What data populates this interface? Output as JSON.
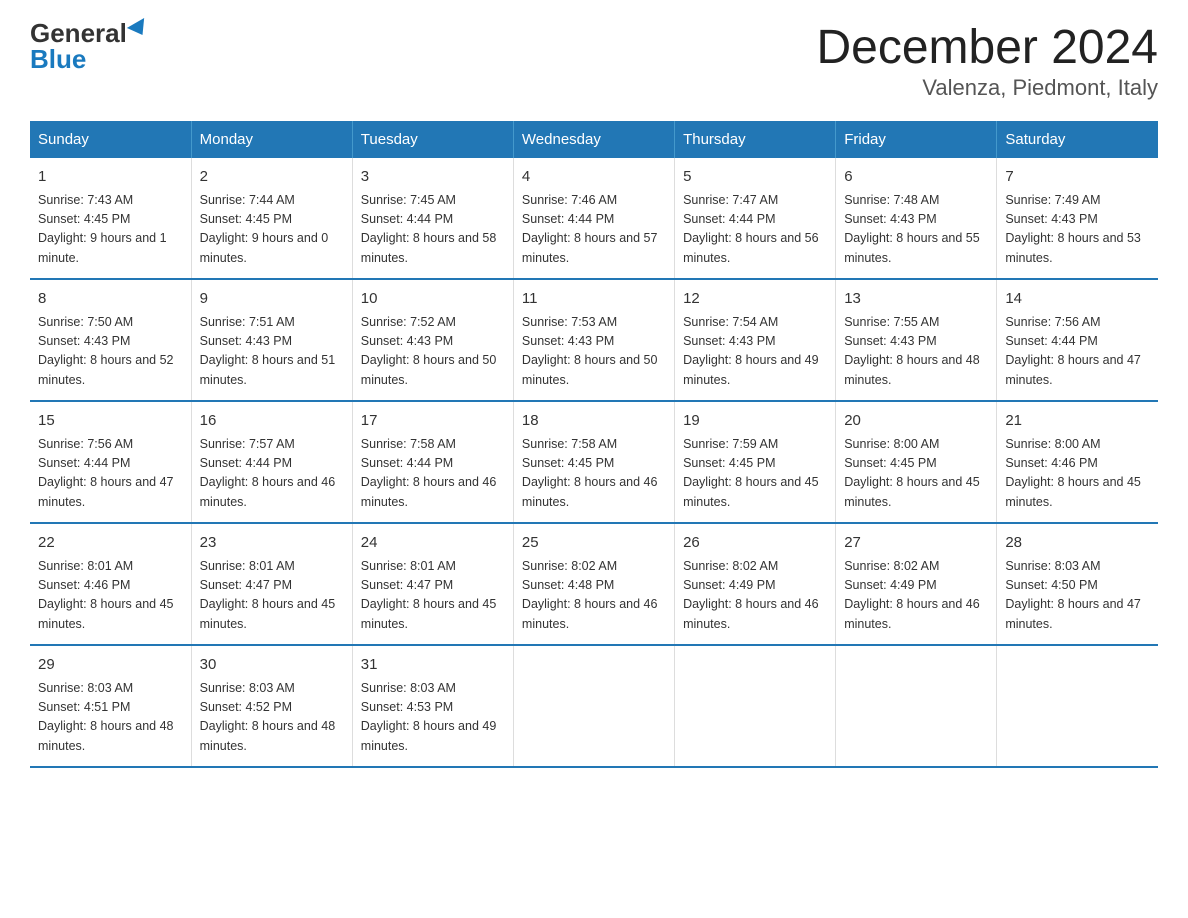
{
  "header": {
    "logo_general": "General",
    "logo_blue": "Blue",
    "title": "December 2024",
    "subtitle": "Valenza, Piedmont, Italy"
  },
  "columns": [
    "Sunday",
    "Monday",
    "Tuesday",
    "Wednesday",
    "Thursday",
    "Friday",
    "Saturday"
  ],
  "weeks": [
    [
      {
        "day": "1",
        "sunrise": "7:43 AM",
        "sunset": "4:45 PM",
        "daylight": "9 hours and 1 minute."
      },
      {
        "day": "2",
        "sunrise": "7:44 AM",
        "sunset": "4:45 PM",
        "daylight": "9 hours and 0 minutes."
      },
      {
        "day": "3",
        "sunrise": "7:45 AM",
        "sunset": "4:44 PM",
        "daylight": "8 hours and 58 minutes."
      },
      {
        "day": "4",
        "sunrise": "7:46 AM",
        "sunset": "4:44 PM",
        "daylight": "8 hours and 57 minutes."
      },
      {
        "day": "5",
        "sunrise": "7:47 AM",
        "sunset": "4:44 PM",
        "daylight": "8 hours and 56 minutes."
      },
      {
        "day": "6",
        "sunrise": "7:48 AM",
        "sunset": "4:43 PM",
        "daylight": "8 hours and 55 minutes."
      },
      {
        "day": "7",
        "sunrise": "7:49 AM",
        "sunset": "4:43 PM",
        "daylight": "8 hours and 53 minutes."
      }
    ],
    [
      {
        "day": "8",
        "sunrise": "7:50 AM",
        "sunset": "4:43 PM",
        "daylight": "8 hours and 52 minutes."
      },
      {
        "day": "9",
        "sunrise": "7:51 AM",
        "sunset": "4:43 PM",
        "daylight": "8 hours and 51 minutes."
      },
      {
        "day": "10",
        "sunrise": "7:52 AM",
        "sunset": "4:43 PM",
        "daylight": "8 hours and 50 minutes."
      },
      {
        "day": "11",
        "sunrise": "7:53 AM",
        "sunset": "4:43 PM",
        "daylight": "8 hours and 50 minutes."
      },
      {
        "day": "12",
        "sunrise": "7:54 AM",
        "sunset": "4:43 PM",
        "daylight": "8 hours and 49 minutes."
      },
      {
        "day": "13",
        "sunrise": "7:55 AM",
        "sunset": "4:43 PM",
        "daylight": "8 hours and 48 minutes."
      },
      {
        "day": "14",
        "sunrise": "7:56 AM",
        "sunset": "4:44 PM",
        "daylight": "8 hours and 47 minutes."
      }
    ],
    [
      {
        "day": "15",
        "sunrise": "7:56 AM",
        "sunset": "4:44 PM",
        "daylight": "8 hours and 47 minutes."
      },
      {
        "day": "16",
        "sunrise": "7:57 AM",
        "sunset": "4:44 PM",
        "daylight": "8 hours and 46 minutes."
      },
      {
        "day": "17",
        "sunrise": "7:58 AM",
        "sunset": "4:44 PM",
        "daylight": "8 hours and 46 minutes."
      },
      {
        "day": "18",
        "sunrise": "7:58 AM",
        "sunset": "4:45 PM",
        "daylight": "8 hours and 46 minutes."
      },
      {
        "day": "19",
        "sunrise": "7:59 AM",
        "sunset": "4:45 PM",
        "daylight": "8 hours and 45 minutes."
      },
      {
        "day": "20",
        "sunrise": "8:00 AM",
        "sunset": "4:45 PM",
        "daylight": "8 hours and 45 minutes."
      },
      {
        "day": "21",
        "sunrise": "8:00 AM",
        "sunset": "4:46 PM",
        "daylight": "8 hours and 45 minutes."
      }
    ],
    [
      {
        "day": "22",
        "sunrise": "8:01 AM",
        "sunset": "4:46 PM",
        "daylight": "8 hours and 45 minutes."
      },
      {
        "day": "23",
        "sunrise": "8:01 AM",
        "sunset": "4:47 PM",
        "daylight": "8 hours and 45 minutes."
      },
      {
        "day": "24",
        "sunrise": "8:01 AM",
        "sunset": "4:47 PM",
        "daylight": "8 hours and 45 minutes."
      },
      {
        "day": "25",
        "sunrise": "8:02 AM",
        "sunset": "4:48 PM",
        "daylight": "8 hours and 46 minutes."
      },
      {
        "day": "26",
        "sunrise": "8:02 AM",
        "sunset": "4:49 PM",
        "daylight": "8 hours and 46 minutes."
      },
      {
        "day": "27",
        "sunrise": "8:02 AM",
        "sunset": "4:49 PM",
        "daylight": "8 hours and 46 minutes."
      },
      {
        "day": "28",
        "sunrise": "8:03 AM",
        "sunset": "4:50 PM",
        "daylight": "8 hours and 47 minutes."
      }
    ],
    [
      {
        "day": "29",
        "sunrise": "8:03 AM",
        "sunset": "4:51 PM",
        "daylight": "8 hours and 48 minutes."
      },
      {
        "day": "30",
        "sunrise": "8:03 AM",
        "sunset": "4:52 PM",
        "daylight": "8 hours and 48 minutes."
      },
      {
        "day": "31",
        "sunrise": "8:03 AM",
        "sunset": "4:53 PM",
        "daylight": "8 hours and 49 minutes."
      },
      null,
      null,
      null,
      null
    ]
  ]
}
